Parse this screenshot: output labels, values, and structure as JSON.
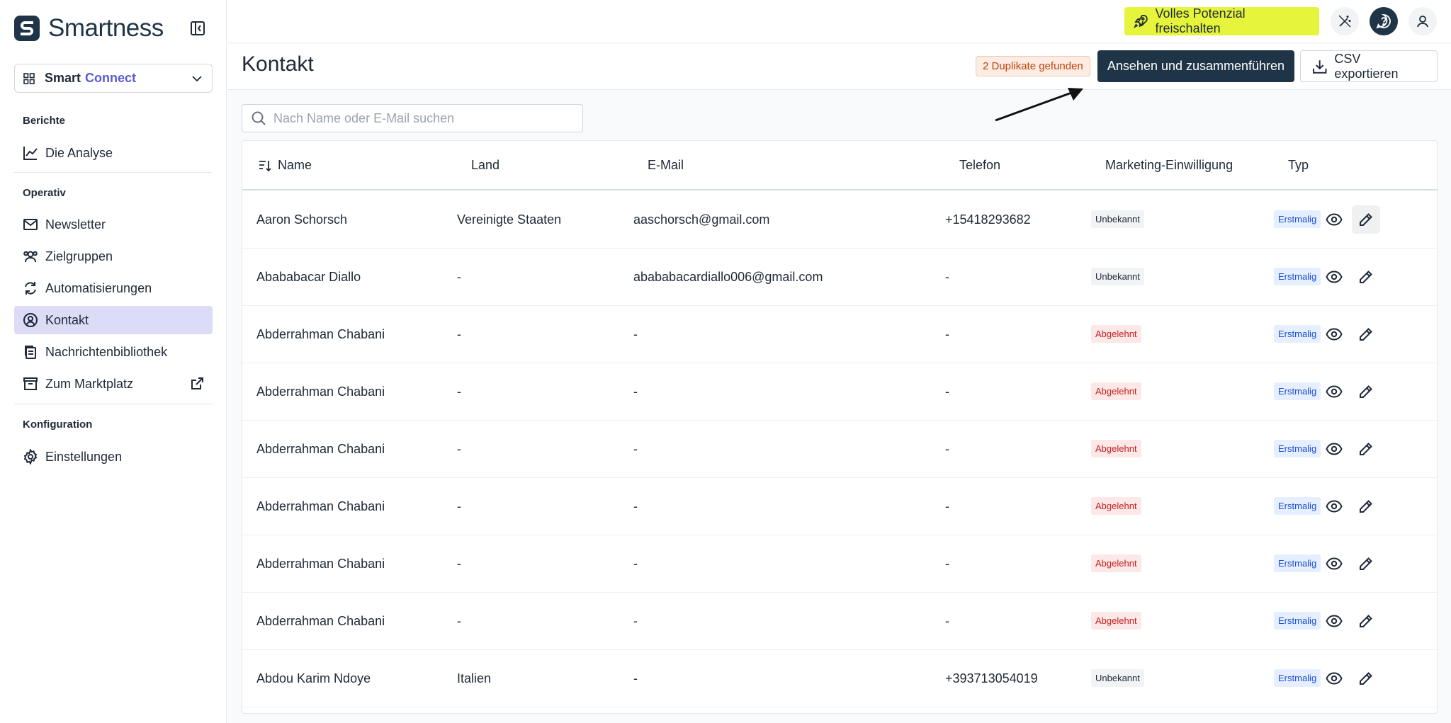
{
  "brand": {
    "name": "Smartness"
  },
  "workspace": {
    "part1": "Smart",
    "part2": "Connect"
  },
  "sidebar": {
    "sections": [
      {
        "label": "Berichte",
        "items": [
          {
            "label": "Die Analyse",
            "icon": "chart-line-icon"
          }
        ]
      },
      {
        "label": "Operativ",
        "items": [
          {
            "label": "Newsletter",
            "icon": "mail-icon"
          },
          {
            "label": "Zielgruppen",
            "icon": "users-icon"
          },
          {
            "label": "Automatisierungen",
            "icon": "refresh-icon"
          },
          {
            "label": "Kontakt",
            "icon": "user-circle-icon",
            "active": true
          },
          {
            "label": "Nachrichtenbibliothek",
            "icon": "library-icon"
          },
          {
            "label": "Zum Marktplatz",
            "icon": "store-icon",
            "external": true
          }
        ]
      },
      {
        "label": "Konfiguration",
        "items": [
          {
            "label": "Einstellungen",
            "icon": "gear-icon"
          }
        ]
      }
    ]
  },
  "topbar": {
    "upgrade_label": "Volles Potenzial freischalten"
  },
  "header": {
    "title": "Kontakt",
    "duplicates_badge": "2 Duplikate gefunden",
    "merge_button": "Ansehen und zusammenführen",
    "export_button": "CSV exportieren"
  },
  "search": {
    "placeholder": "Nach Name oder E-Mail suchen",
    "value": ""
  },
  "table": {
    "columns": [
      "Name",
      "Land",
      "E-Mail",
      "Telefon",
      "Marketing-Einwilligung",
      "Typ"
    ],
    "rows": [
      {
        "name": "Aaron Schorsch",
        "country": "Vereinigte Staaten",
        "email": "aaschorsch@gmail.com",
        "phone": "+15418293682",
        "consent": "Unbekannt",
        "type": "Erstmalig"
      },
      {
        "name": "Abababacar Diallo",
        "country": "-",
        "email": "abababacardiallo006@gmail.com",
        "phone": "-",
        "consent": "Unbekannt",
        "type": "Erstmalig"
      },
      {
        "name": "Abderrahman Chabani",
        "country": "-",
        "email": "-",
        "phone": "-",
        "consent": "Abgelehnt",
        "type": "Erstmalig"
      },
      {
        "name": "Abderrahman Chabani",
        "country": "-",
        "email": "-",
        "phone": "-",
        "consent": "Abgelehnt",
        "type": "Erstmalig"
      },
      {
        "name": "Abderrahman Chabani",
        "country": "-",
        "email": "-",
        "phone": "-",
        "consent": "Abgelehnt",
        "type": "Erstmalig"
      },
      {
        "name": "Abderrahman Chabani",
        "country": "-",
        "email": "-",
        "phone": "-",
        "consent": "Abgelehnt",
        "type": "Erstmalig"
      },
      {
        "name": "Abderrahman Chabani",
        "country": "-",
        "email": "-",
        "phone": "-",
        "consent": "Abgelehnt",
        "type": "Erstmalig"
      },
      {
        "name": "Abderrahman Chabani",
        "country": "-",
        "email": "-",
        "phone": "-",
        "consent": "Abgelehnt",
        "type": "Erstmalig"
      },
      {
        "name": "Abdou Karim Ndoye",
        "country": "Italien",
        "email": "-",
        "phone": "+393713054019",
        "consent": "Unbekannt",
        "type": "Erstmalig"
      }
    ]
  }
}
